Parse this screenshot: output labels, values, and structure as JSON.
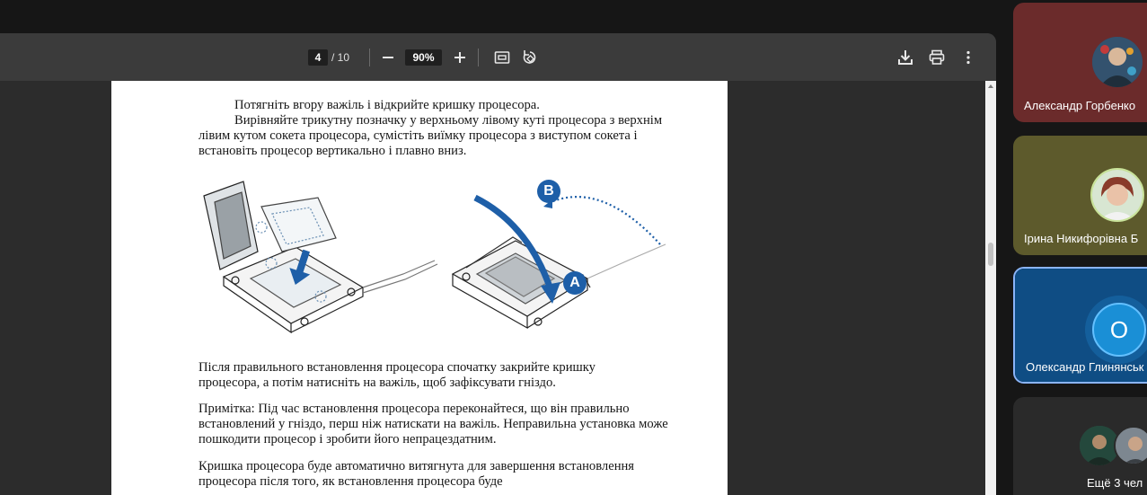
{
  "toolbar": {
    "page_current": "4",
    "page_total": "/ 10",
    "zoom_value": "90%",
    "zoom_out_icon": "minus-icon",
    "zoom_in_icon": "plus-icon",
    "fit_icon": "fit-page-icon",
    "rotate_icon": "rotate-icon",
    "download_icon": "download-icon",
    "print_icon": "print-icon",
    "more_icon": "more-vert-icon"
  },
  "document": {
    "paragraphs": [
      "Потягніть вгору важіль і відкрийте кришку процесора.",
      "Вирівняйте трикутну позначку у верхньому лівому куті процесора з верхнім лівим кутом сокета процесора, сумістіть виїмку процесора з виступом сокета і встановіть процесор вертикально і плавно вниз.",
      "Після правильного встановлення процесора спочатку закрийте кришку процесора, а потім натисніть на важіль, щоб зафіксувати гніздо.",
      "Примітка: Під час встановлення процесора переконайтеся, що він правильно встановлений у гніздо, перш ніж натискати на важіль. Неправильна установка може пошкодити процесор і зробити його непрацездатним.",
      "Кришка процесора буде автоматично витягнута для завершення встановлення процесора після того, як встановлення процесора буде"
    ],
    "figure_labels": {
      "badge_a": "A",
      "badge_b": "B"
    }
  },
  "participants": [
    {
      "name": "Александр Горбенко",
      "tile_color": "#6b2b2b"
    },
    {
      "name": "Ірина Никифорівна Б",
      "tile_color": "#5d5a2c"
    },
    {
      "name": "Олександр Глинянськ",
      "tile_color": "#0f4d84",
      "initial": "О",
      "active": true
    },
    {
      "name": "Ещё 3 чел",
      "tile_color": "#2a2a2a"
    }
  ],
  "colors": {
    "accent_blue": "#1e5fa8",
    "active_border": "#8ab4f8"
  }
}
